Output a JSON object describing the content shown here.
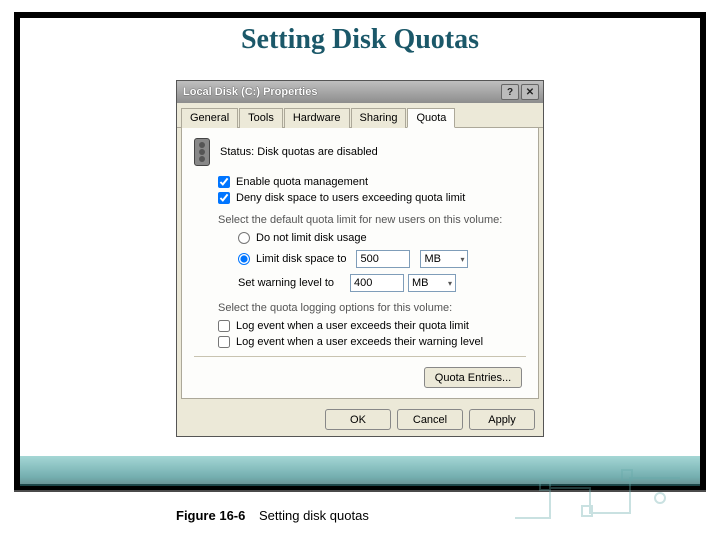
{
  "slide": {
    "title": "Setting Disk Quotas"
  },
  "dialog": {
    "title": "Local Disk (C:) Properties",
    "help_btn": "?",
    "close_btn": "✕",
    "tabs": {
      "general": "General",
      "tools": "Tools",
      "hardware": "Hardware",
      "sharing": "Sharing",
      "quota": "Quota"
    },
    "status_label": "Status:  Disk quotas are disabled",
    "enable_quota": "Enable quota management",
    "deny_space": "Deny disk space to users exceeding quota limit",
    "default_limit_label": "Select the default quota limit for new users on this volume:",
    "radio_no_limit": "Do not limit disk usage",
    "radio_limit": "Limit disk space to",
    "limit_value": "500",
    "limit_unit": "MB",
    "warning_label": "Set warning level to",
    "warning_value": "400",
    "warning_unit": "MB",
    "logging_label": "Select the quota logging options for this volume:",
    "log_quota": "Log event when a user exceeds their quota limit",
    "log_warning": "Log event when a user exceeds their warning level",
    "quota_entries_btn": "Quota Entries...",
    "ok": "OK",
    "cancel": "Cancel",
    "apply": "Apply"
  },
  "figure": {
    "number": "Figure 16-6",
    "caption": "Setting disk quotas"
  }
}
